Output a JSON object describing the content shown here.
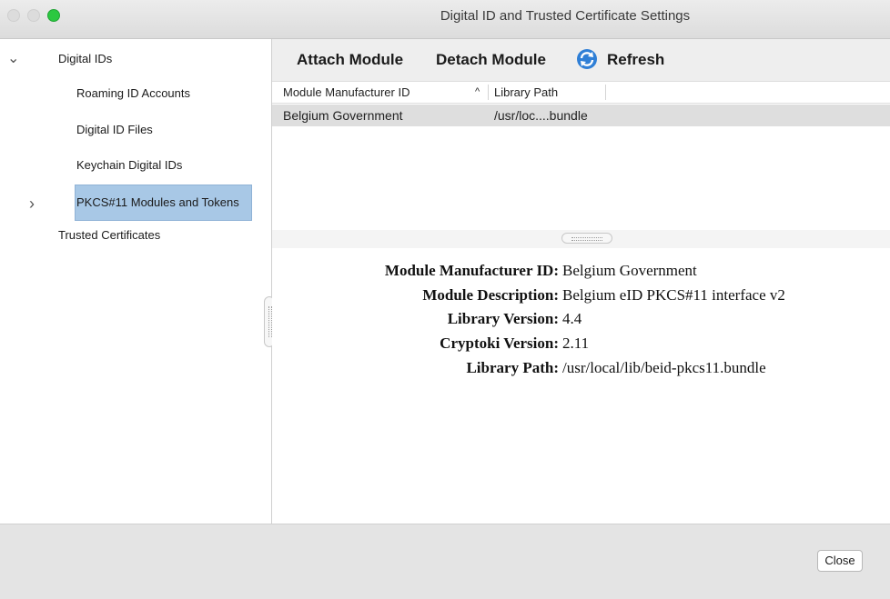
{
  "window": {
    "title": "Digital ID and Trusted Certificate Settings"
  },
  "sidebar": {
    "items": [
      {
        "label": "Digital IDs",
        "expanded": true
      },
      {
        "label": "Roaming ID Accounts"
      },
      {
        "label": "Digital ID Files"
      },
      {
        "label": "Keychain Digital IDs"
      },
      {
        "label": "PKCS#11 Modules and Tokens",
        "selected": true,
        "collapsed": true
      },
      {
        "label": "Trusted Certificates"
      }
    ]
  },
  "toolbar": {
    "attach_label": "Attach Module",
    "detach_label": "Detach Module",
    "refresh_label": "Refresh"
  },
  "table": {
    "columns": [
      "Module Manufacturer ID",
      "Library Path"
    ],
    "sort_indicator": "^",
    "rows": [
      {
        "manufacturer": "Belgium Government",
        "path": "/usr/loc....bundle"
      }
    ]
  },
  "details": [
    {
      "key": "Module Manufacturer ID:",
      "value": "Belgium Government"
    },
    {
      "key": "Module Description:",
      "value": "Belgium eID PKCS#11 interface v2"
    },
    {
      "key": "Library Version:",
      "value": "4.4"
    },
    {
      "key": "Cryptoki Version:",
      "value": "2.11"
    },
    {
      "key": "Library Path:",
      "value": "/usr/local/lib/beid-pkcs11.bundle"
    }
  ],
  "footer": {
    "close_label": "Close"
  },
  "colors": {
    "selection": "#a8c8e6",
    "refresh_icon": "#2f7fd6",
    "maximize_button": "#2bc840"
  }
}
